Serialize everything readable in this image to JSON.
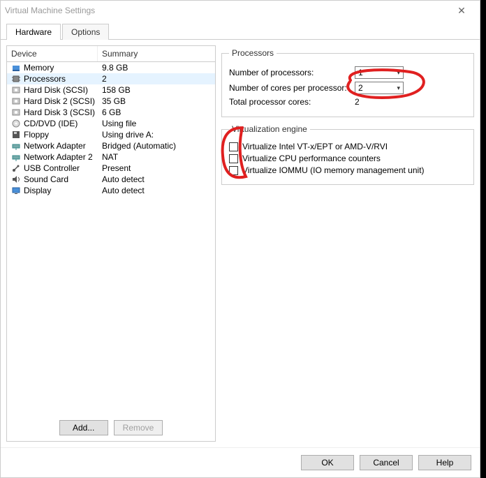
{
  "window": {
    "title": "Virtual Machine Settings"
  },
  "tabs": {
    "hardware": "Hardware",
    "options": "Options"
  },
  "columns": {
    "device": "Device",
    "summary": "Summary"
  },
  "devices": [
    {
      "icon": "memory-icon",
      "name": "Memory",
      "summary": "9.8 GB"
    },
    {
      "icon": "cpu-icon",
      "name": "Processors",
      "summary": "2",
      "selected": true
    },
    {
      "icon": "disk-icon",
      "name": "Hard Disk (SCSI)",
      "summary": "158 GB"
    },
    {
      "icon": "disk-icon",
      "name": "Hard Disk 2 (SCSI)",
      "summary": "35 GB"
    },
    {
      "icon": "disk-icon",
      "name": "Hard Disk 3 (SCSI)",
      "summary": "6 GB"
    },
    {
      "icon": "cd-icon",
      "name": "CD/DVD (IDE)",
      "summary": "Using file"
    },
    {
      "icon": "floppy-icon",
      "name": "Floppy",
      "summary": "Using drive A:"
    },
    {
      "icon": "net-icon",
      "name": "Network Adapter",
      "summary": "Bridged (Automatic)"
    },
    {
      "icon": "net-icon",
      "name": "Network Adapter 2",
      "summary": "NAT"
    },
    {
      "icon": "usb-icon",
      "name": "USB Controller",
      "summary": "Present"
    },
    {
      "icon": "sound-icon",
      "name": "Sound Card",
      "summary": "Auto detect"
    },
    {
      "icon": "display-icon",
      "name": "Display",
      "summary": "Auto detect"
    }
  ],
  "left_buttons": {
    "add": "Add...",
    "remove": "Remove"
  },
  "processors": {
    "legend": "Processors",
    "num_proc_label": "Number of processors:",
    "num_proc_value": "1",
    "cores_label": "Number of cores per processor:",
    "cores_value": "2",
    "total_label": "Total processor cores:",
    "total_value": "2"
  },
  "virt": {
    "legend": "Virtualization engine",
    "vt": "Virtualize Intel VT-x/EPT or AMD-V/RVI",
    "perf": "Virtualize CPU performance counters",
    "iommu": "Virtualize IOMMU (IO memory management unit)"
  },
  "footer": {
    "ok": "OK",
    "cancel": "Cancel",
    "help": "Help"
  }
}
